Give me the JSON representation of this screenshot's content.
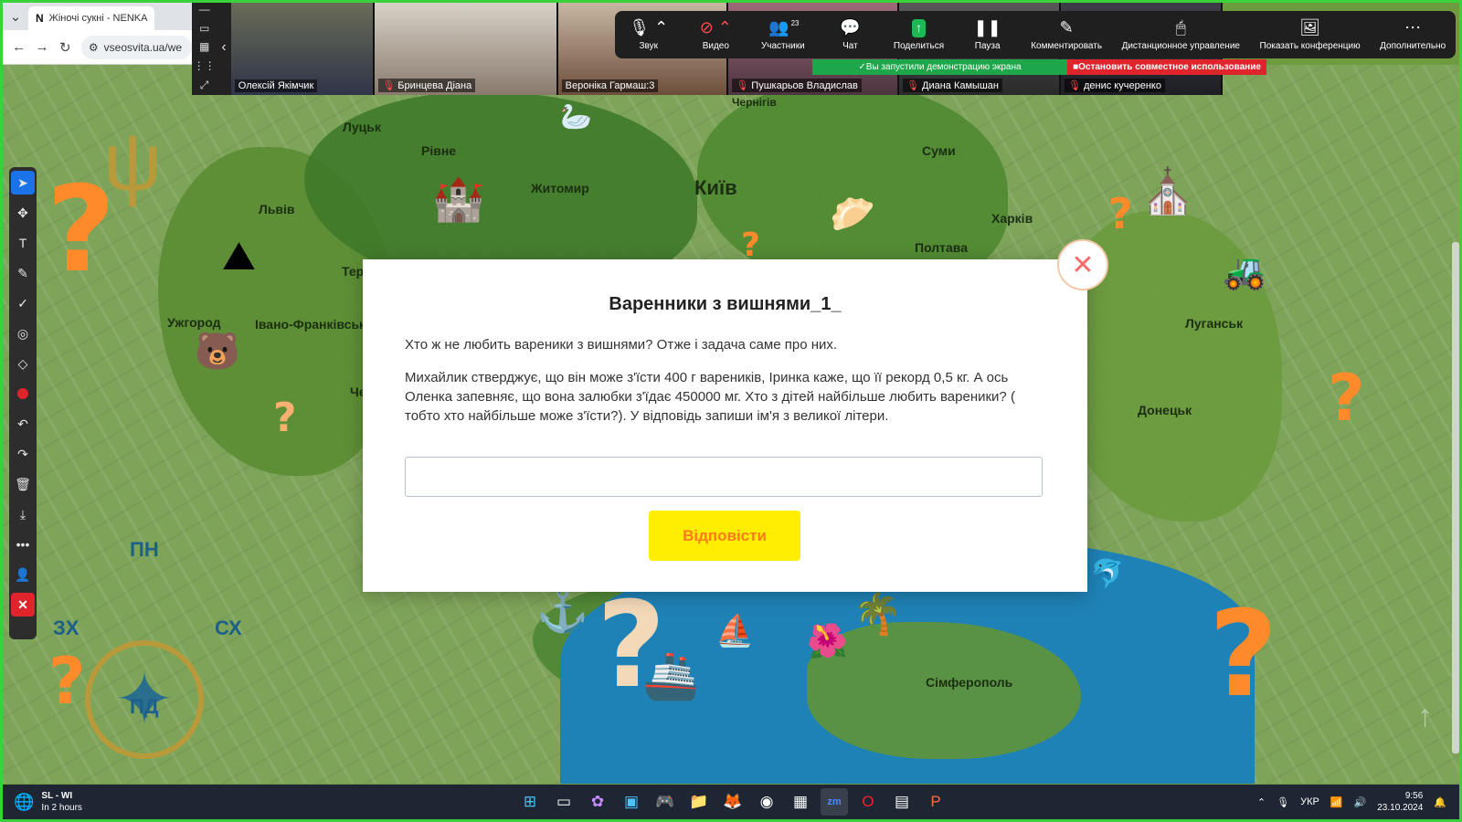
{
  "browser": {
    "tab_title": "Жіночі сукні - NENKA",
    "tab_favicon": "N",
    "url": "vseosvita.ua/we"
  },
  "map": {
    "cities": [
      "Луцьк",
      "Рівне",
      "Чернігів",
      "Суми",
      "Львів",
      "Житомир",
      "Київ",
      "Харків",
      "Полтава",
      "Тер",
      "Ужгород",
      "Івано-Франківськ",
      "Луганськ",
      "Донецьк",
      "Сімферополь",
      "Че"
    ],
    "compass": {
      "north": "ПН",
      "south": "ПД",
      "west": "ЗХ",
      "east": "СХ"
    }
  },
  "annotation_toolbar": {
    "tools": [
      "select-icon",
      "move-icon",
      "text-icon",
      "pen-icon",
      "check-icon",
      "spotlight-icon",
      "eraser-icon",
      "color-icon",
      "undo-icon",
      "redo-icon",
      "delete-icon",
      "save-icon",
      "more-icon",
      "participant-icon",
      "close-icon"
    ]
  },
  "gallery": {
    "tiles": [
      {
        "name": "Олексій Якімчик",
        "muted": false
      },
      {
        "name": "Бринцева Діана",
        "muted": true
      },
      {
        "name": "Вероніка Гармаш:3",
        "muted": false
      },
      {
        "name": "Пушкарьов Владислав",
        "muted": true
      },
      {
        "name": "Диана Камышан",
        "muted": true
      },
      {
        "name": "денис кучеренко",
        "muted": true
      }
    ]
  },
  "zoom_controls": {
    "audio": "Звук",
    "video": "Видео",
    "participants": "Участники",
    "participants_count": "23",
    "chat": "Чат",
    "share": "Поделиться",
    "pause": "Пауза",
    "annotate": "Комментировать",
    "remote_control": "Дистанционное управление",
    "show_meeting": "Показать конференцию",
    "more": "Дополнительно",
    "share_banner": "Вы запустили демонстрацию экрана",
    "stop_share": "Остановить совместное использование"
  },
  "modal": {
    "title": "Варенники з вишнями_1_",
    "paragraph1": "Хто ж не любить вареники з вишнями? Отже і задача саме про них.",
    "paragraph2": "Михайлик стверджує, що він може з'їсти 400 г вареників, Іринка каже, що її рекорд 0,5 кг. А ось Оленка запевняє, що вона залюбки з'їдає 450000 мг. Хто з дітей найбільше любить вареники? ( тобто хто найбільше може з'їсти?). У відповідь запиши ім'я з великої літери.",
    "answer_value": "",
    "answer_placeholder": "",
    "submit_label": "Відповісти"
  },
  "taskbar": {
    "weather_line1": "SL - WI",
    "weather_line2": "In 2 hours",
    "language": "УКР",
    "time": "9:56",
    "date": "23.10.2024"
  },
  "colors": {
    "accent_yellow": "#ffee00",
    "accent_orange": "#ff7a1a",
    "share_green": "#1ea74a",
    "stop_red": "#e0242c"
  }
}
